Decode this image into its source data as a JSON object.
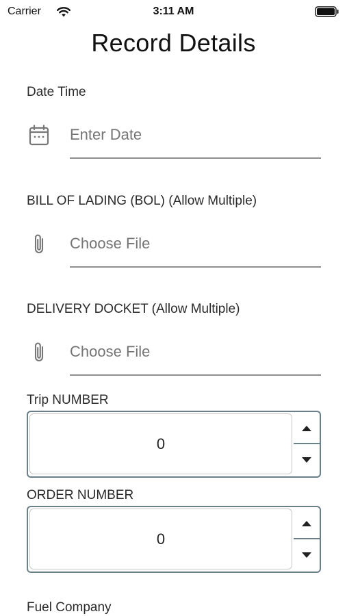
{
  "status_bar": {
    "carrier": "Carrier",
    "time": "3:11 AM",
    "wifi_icon": "wifi-icon",
    "battery_icon": "battery-icon"
  },
  "page": {
    "title": "Record Details"
  },
  "fields": {
    "date_time": {
      "label": "Date Time",
      "placeholder": "Enter Date",
      "icon": "calendar-icon"
    },
    "bol": {
      "label": "BILL OF LADING (BOL) (Allow Multiple)",
      "placeholder": "Choose File",
      "icon": "paperclip-icon"
    },
    "delivery_docket": {
      "label": "DELIVERY DOCKET (Allow Multiple)",
      "placeholder": "Choose File",
      "icon": "paperclip-icon"
    },
    "trip_number": {
      "label": "Trip NUMBER",
      "value": "0"
    },
    "order_number": {
      "label": "ORDER NUMBER",
      "value": "0"
    },
    "fuel_company": {
      "label": "Fuel Company"
    }
  },
  "colors": {
    "stepper_border": "#6a7f88",
    "underline": "#8e8e8e",
    "placeholder": "#8a8a8a"
  }
}
